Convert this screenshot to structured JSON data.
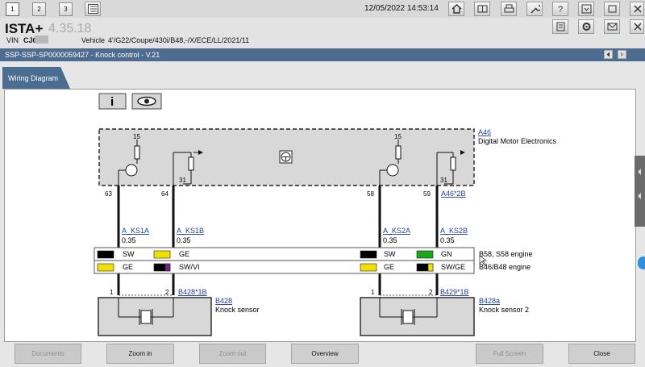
{
  "tabs": [
    "1",
    "2",
    "3"
  ],
  "datetime": "12/05/2022 14:53:14",
  "app": {
    "title": "ISTA+",
    "version": "4.35.18"
  },
  "vehicle_info": {
    "vin_label": "VIN",
    "vin_value": "CJ6",
    "vehicle_label": "Vehicle",
    "vehicle_value": "4'/G22/Coupe/430i/B48,-/X/ECE/LL/2021/11"
  },
  "document": {
    "title": "SSP-SSP-SP0000059427 - Knock control - V.21"
  },
  "view_tab": "Wiring Diagram",
  "diagram": {
    "dme": {
      "id": "A46",
      "name": "Digital Motor Electronics",
      "connector": "A46*2B"
    },
    "pin_labels": {
      "supply": "15",
      "ground": "31"
    },
    "pins": [
      "63",
      "64",
      "58",
      "59"
    ],
    "wires": [
      {
        "name": "A_KS1A",
        "size": "0.35"
      },
      {
        "name": "A_KS1B",
        "size": "0.35"
      },
      {
        "name": "A_KS2A",
        "size": "0.35"
      },
      {
        "name": "A_KS2B",
        "size": "0.35"
      }
    ],
    "engine_rows": [
      {
        "label": "B58, S58 engine",
        "colors": [
          "SW",
          "GE",
          "SW",
          "GN"
        ]
      },
      {
        "label": "B46/B48 engine",
        "colors": [
          "GE",
          "SW/VI",
          "GE",
          "SW/GE"
        ]
      }
    ],
    "sensor_pins": [
      "1",
      "2",
      "1",
      "2"
    ],
    "sensors": [
      {
        "id": "B428",
        "name": "Knock sensor",
        "connector": "B428*1B"
      },
      {
        "id": "B428a",
        "name": "Knock sensor 2",
        "connector": "B429*1B"
      }
    ],
    "palette": {
      "SW": "#000000",
      "GE": "#f2e000",
      "GN": "#1aa51a",
      "VI": "#7a1f8c"
    }
  },
  "buttons": {
    "documents": "Documents",
    "zoom_in": "Zoom in",
    "zoom_out": "Zoom out",
    "overview": "Overview",
    "full_screen": "Full Screen",
    "close": "Close"
  }
}
